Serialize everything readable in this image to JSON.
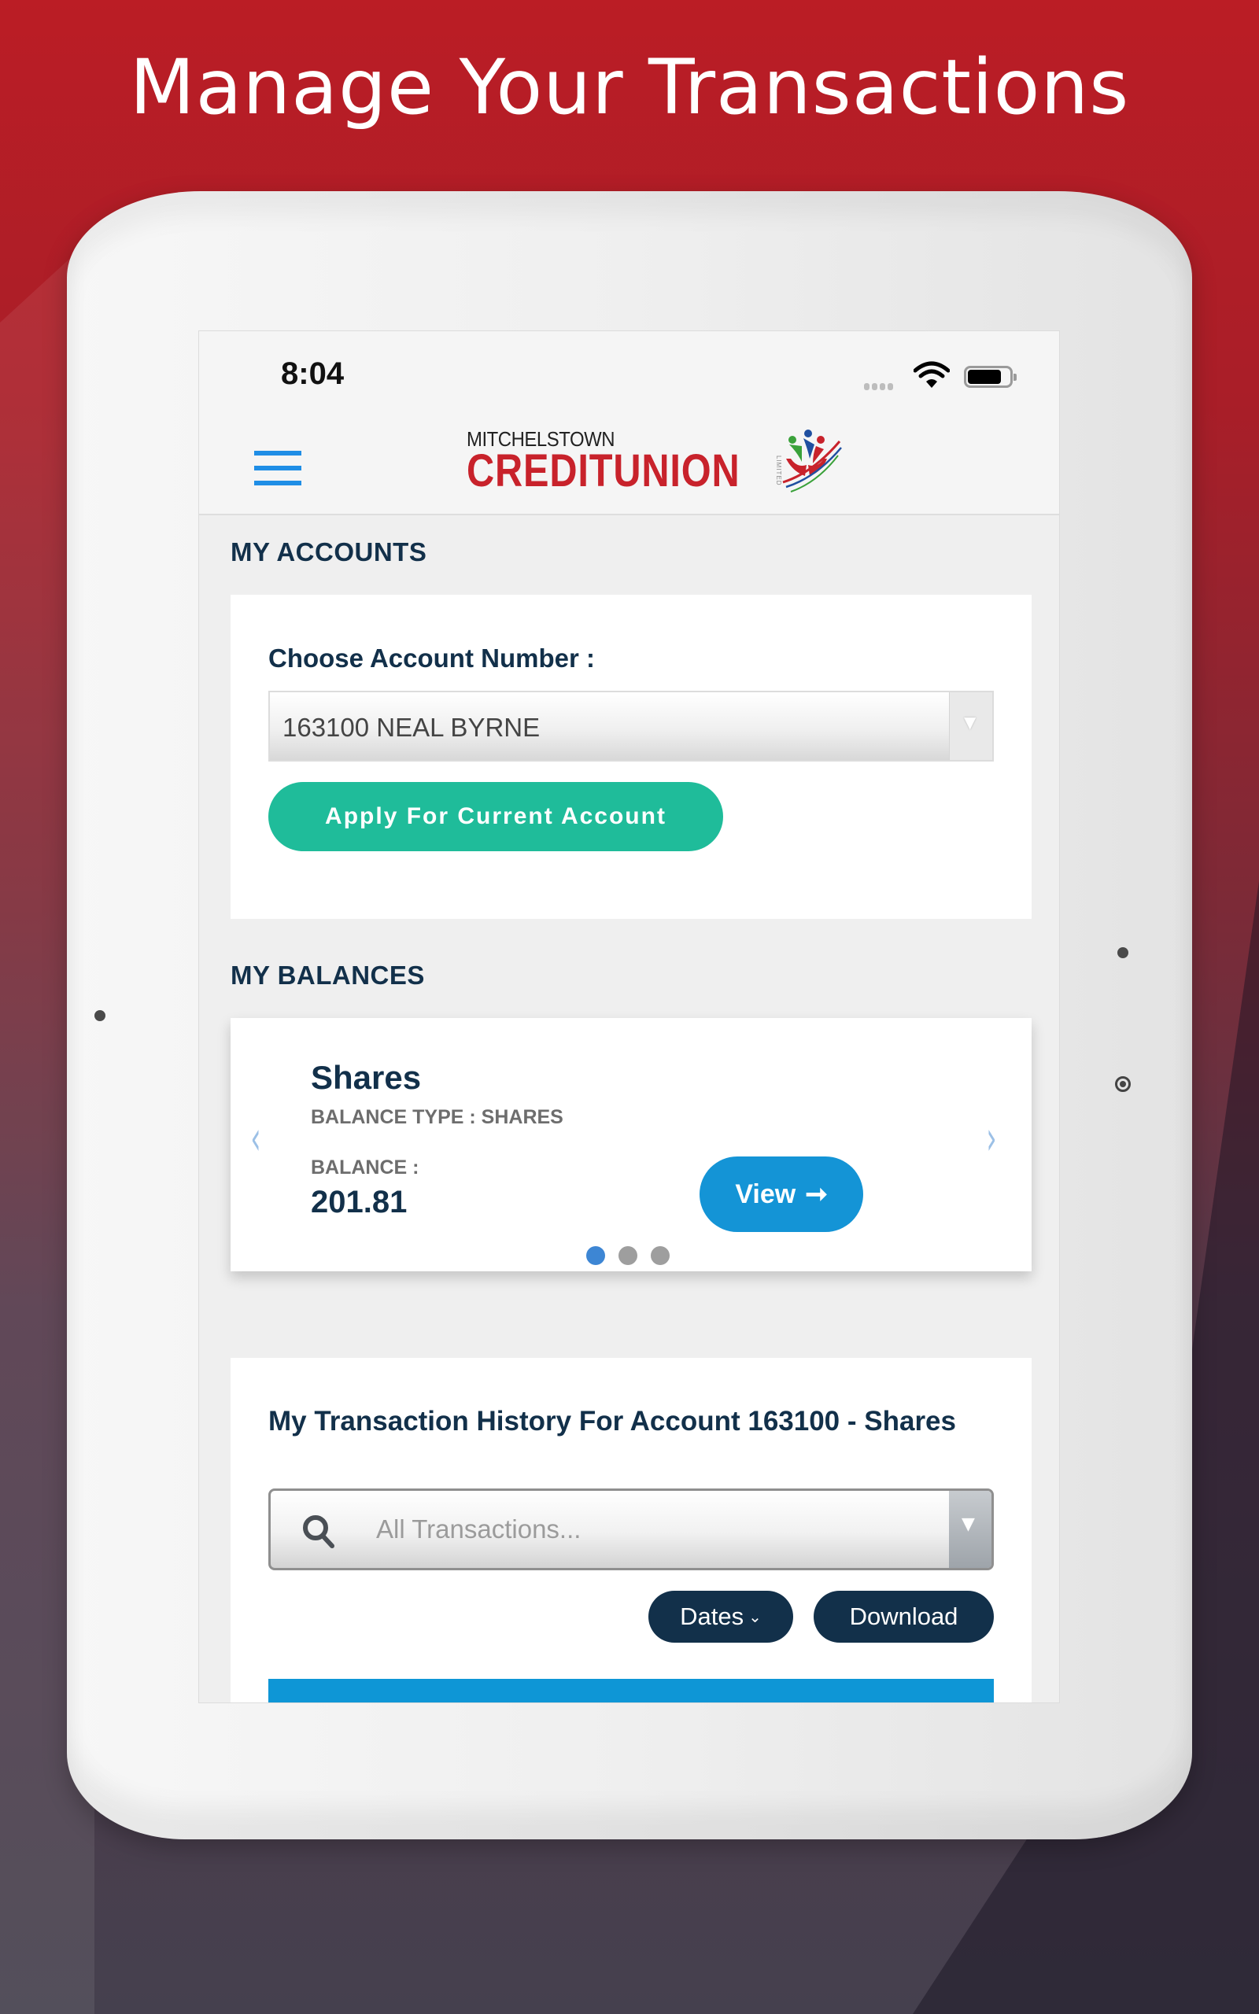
{
  "headline": "Manage Your Transactions",
  "status_bar": {
    "time": "8:04",
    "icons": [
      "signal-icon",
      "wifi-icon",
      "battery-icon"
    ]
  },
  "app_bar": {
    "menu_icon": "hamburger-menu-icon",
    "logo": {
      "top_text": "MITCHELSTOWN",
      "main_text": "CREDITUNION",
      "side_text": "LIMITED",
      "emblem_icon": "hands-people-emblem-icon"
    }
  },
  "accounts": {
    "section_title": "MY ACCOUNTS",
    "choose_label": "Choose Account Number :",
    "selected_account": "163100 NEAL BYRNE",
    "apply_button": "Apply For Current Account"
  },
  "balances": {
    "section_title": "MY BALANCES",
    "card": {
      "title": "Shares",
      "type_line": "BALANCE TYPE : SHARES",
      "balance_label": "BALANCE :",
      "balance_value": "201.81",
      "view_button": "View",
      "view_icon": "arrow-right-icon"
    },
    "prev_icon": "chevron-left-icon",
    "next_icon": "chevron-right-icon",
    "pagination": {
      "total": 3,
      "active": 1
    }
  },
  "transactions": {
    "title": "My Transaction History For Account 163100 - Shares",
    "filter_placeholder": "All Transactions...",
    "dates_button": "Dates",
    "download_button": "Download"
  },
  "colors": {
    "brand_red": "#c8222b",
    "navy": "#12304a",
    "green": "#1fbc9a",
    "blue": "#1494d6",
    "menu_blue": "#1f8ee6"
  }
}
